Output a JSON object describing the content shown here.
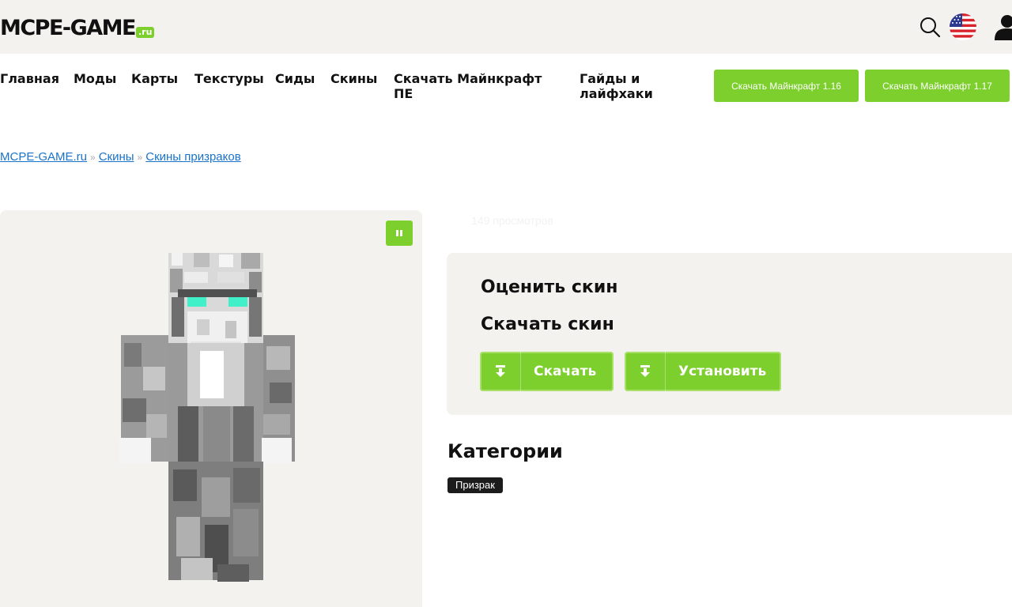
{
  "header": {
    "logo_text": "MCPE-GAME",
    "logo_suffix": ".ru",
    "icons": [
      "search-icon",
      "us-flag-icon",
      "user-icon"
    ]
  },
  "nav": {
    "items": [
      {
        "label": "Главная"
      },
      {
        "label": "Моды"
      },
      {
        "label": "Карты"
      },
      {
        "label": "Текстуры"
      },
      {
        "label": "Сиды"
      },
      {
        "label": "Скины"
      },
      {
        "label": "Скачать Майнкрафт ПЕ"
      },
      {
        "label": "Гайды и лайфхаки"
      }
    ],
    "buttons": [
      {
        "label": "Скачать Майнкрафт 1.16"
      },
      {
        "label": "Скачать Майнкрафт 1.17"
      }
    ]
  },
  "breadcrumb": {
    "items": [
      "MCPE-GAME.ru",
      "Скины",
      "Скины призраков"
    ],
    "separator": "»"
  },
  "skin": {
    "views": "149 просмотров",
    "rate_label": "Оценить скин",
    "download_heading": "Скачать скин",
    "download_button": "Скачать",
    "install_button": "Установить"
  },
  "categories": {
    "title": "Категории",
    "tags": [
      "Призрак"
    ]
  },
  "colors": {
    "accent": "#7ccf2c",
    "panel_bg": "#f4f2ee",
    "link": "#1a73c9",
    "tag_bg": "#1c1c1c"
  }
}
